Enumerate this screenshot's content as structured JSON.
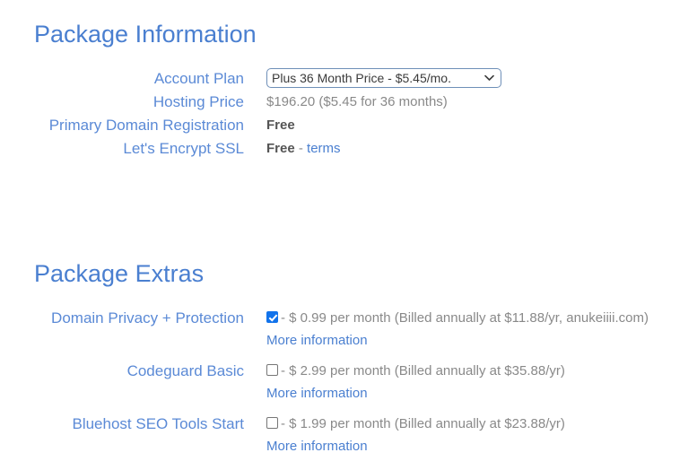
{
  "sections": {
    "package_information": {
      "heading": "Package Information",
      "rows": [
        {
          "label": "Account Plan",
          "type": "select",
          "selected": "Plus 36 Month Price - $5.45/mo.",
          "options": [
            "Plus 36 Month Price - $5.45/mo."
          ]
        },
        {
          "label": "Hosting Price",
          "type": "text",
          "value": "$196.20  ($5.45 for 36 months)"
        },
        {
          "label": "Primary Domain Registration",
          "type": "strong",
          "value": "Free"
        },
        {
          "label": "Let's Encrypt SSL",
          "type": "strong_link",
          "value": "Free",
          "separator": "-",
          "link": "terms"
        }
      ]
    },
    "package_extras": {
      "heading": "Package Extras",
      "rows": [
        {
          "label": "Domain Privacy + Protection",
          "checked": true,
          "description": "- $ 0.99 per month (Billed annually at $11.88/yr, anukeiiii.com)",
          "more_info": "More information"
        },
        {
          "label": "Codeguard Basic",
          "checked": false,
          "description": "- $ 2.99 per month (Billed annually at $35.88/yr)",
          "more_info": "More information"
        },
        {
          "label": "Bluehost SEO Tools Start",
          "checked": false,
          "description": "- $ 1.99 per month (Billed annually at $23.88/yr)",
          "more_info": "More information"
        }
      ]
    }
  },
  "colors": {
    "heading_blue": "#4a7fd0",
    "label_blue": "#5b8ad6",
    "link_blue": "#4a7fd0",
    "value_gray": "#898989",
    "value_strong": "#555555",
    "checkbox_checked": "#1273eb"
  },
  "icons": {
    "chevron_down": "chevron-down-icon",
    "checkmark": "checkmark-icon"
  }
}
